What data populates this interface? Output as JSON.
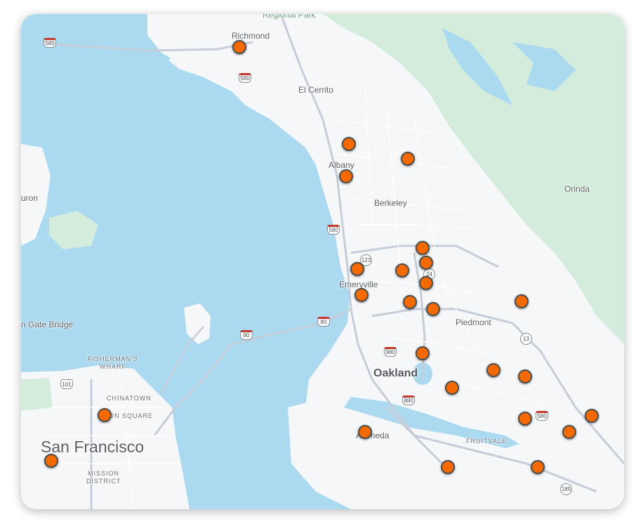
{
  "map": {
    "colors": {
      "water": "#aad9f0",
      "land": "#f6f7f8",
      "park": "#d3ecdb",
      "road": "#ffffff",
      "highway": "#c5cdd8",
      "marker_fill": "#f56a00",
      "marker_stroke": "#4d4d4d"
    },
    "places": {
      "regional_park": "Regional Park",
      "richmond": "Richmond",
      "el_cerrito": "El Cerrito",
      "albany": "Albany",
      "berkeley": "Berkeley",
      "orinda": "Orinda",
      "tiburon": "uron",
      "emeryville": "Emeryville",
      "piedmont": "Piedmont",
      "golden_gate": "n Gate Bridge",
      "fishermans_wharf_1": "FISHERMAN'S",
      "fishermans_wharf_2": "WHARF",
      "chinatown": "CHINATOWN",
      "union_square": "ON SQUARE",
      "san_francisco": "San Francisco",
      "mission_1": "MISSION",
      "mission_2": "DISTRICT",
      "oakland": "Oakland",
      "alameda": "Alameda",
      "fruitvale": "FRUITVALE"
    },
    "shields": {
      "i580_west": "580",
      "i580_richmond": "580",
      "i580_berkeley": "580",
      "i80_bay": "80",
      "i80_east": "80",
      "i980": "980",
      "i880": "880",
      "i580_east": "580",
      "ca123": "123",
      "ca24": "24",
      "ca13": "13",
      "us101": "101",
      "ca185": "185"
    },
    "marker_count": 27
  }
}
